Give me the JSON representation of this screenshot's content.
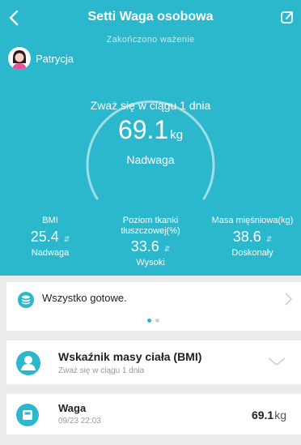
{
  "header": {
    "title": "Setti Waga osobowa",
    "subtitle": "Zakończono ważenie",
    "back_icon": "chevron-left-icon",
    "share_icon": "share-icon"
  },
  "user": {
    "name": "Patrycja",
    "avatar_icon": "user-avatar-icon"
  },
  "gauge": {
    "prompt": "Zważ się w ciągu 1 dnia",
    "value": "69.1",
    "unit": "kg",
    "status": "Nadwaga"
  },
  "metrics": [
    {
      "label": "BMI",
      "value": "25.4",
      "status": "Nadwaga"
    },
    {
      "label": "Poziom tkanki tłuszczowej(%)",
      "value": "33.6",
      "status": "Wysoki"
    },
    {
      "label": "Masa mięśniowa(kg)",
      "value": "38.6",
      "status": "Doskonały"
    }
  ],
  "banner": {
    "text": "Wszystko gotowe.",
    "icon": "database-icon",
    "page": 1,
    "pages": 2
  },
  "bmi_card": {
    "title": "Wskaźnik masy ciała (BMI)",
    "subtitle": "Zważ się w ciągu 1 dnia",
    "icon": "person-icon"
  },
  "weight_card": {
    "title": "Waga",
    "date": "09/23 22:03",
    "value": "69.1",
    "unit": "kg",
    "icon": "scale-icon"
  },
  "colors": {
    "accent": "#2bb7cc",
    "background": "#ececee"
  }
}
